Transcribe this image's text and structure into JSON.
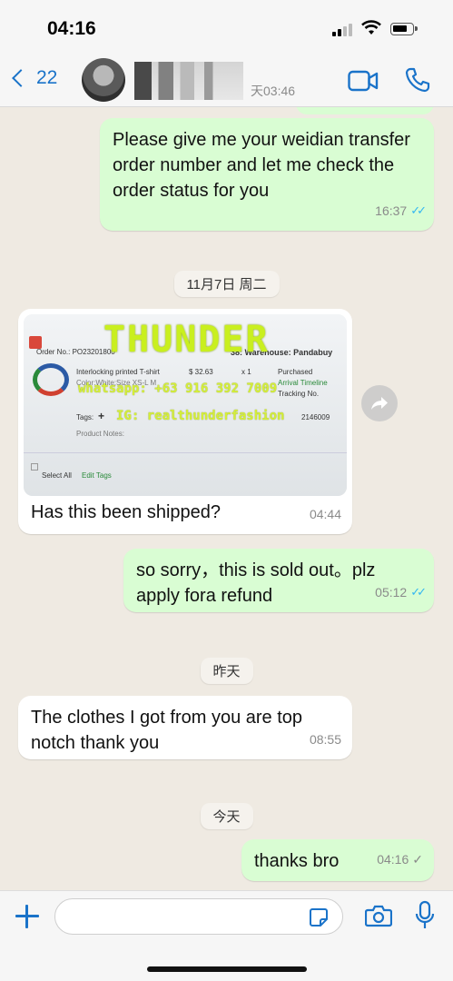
{
  "status": {
    "time": "04:16"
  },
  "header": {
    "back_count": "22",
    "last_seen": "天03:46"
  },
  "messages": [
    {
      "text": "Please give me your weidian transfer order number and let me check the order status for you",
      "time": "16:37"
    },
    {
      "date": "11月7日 周二"
    },
    {
      "text": "Has this been shipped?",
      "time": "04:44",
      "image": {
        "watermark": "THUNDER",
        "whatsapp": "whatsapp: +63 916 392 7009",
        "ig": "IG: realthunderfashion",
        "order_no": "Order No.: PO23201800",
        "warehouse": "38: Warehouse: Pandabuy",
        "product": "Interlocking printed T-shirt",
        "price": "$ 32.63",
        "qty": "x 1",
        "status": "Purchased",
        "color_size": "Color:White;Size XS-L M",
        "arrival": "Arrival Timeline",
        "tracking": "Tracking No.",
        "tags": "Tags:",
        "tags_plus": "+",
        "number": "2146009",
        "notes": "Product Notes:",
        "select_all": "Select All",
        "edit_tags": "Edit Tags"
      }
    },
    {
      "text": "so sorry，this is sold out。plz apply fora refund",
      "time": "05:12"
    },
    {
      "date": "昨天"
    },
    {
      "text": "The clothes I got from you are top notch thank you",
      "time": "08:55"
    },
    {
      "date": "今天"
    },
    {
      "text": "thanks bro",
      "time": "04:16"
    }
  ],
  "input": {
    "placeholder": ""
  },
  "colors": {
    "accent": "#1a73c9",
    "outgoing": "#d9fdd3",
    "incoming": "#ffffff",
    "read_tick": "#34b7f1"
  }
}
